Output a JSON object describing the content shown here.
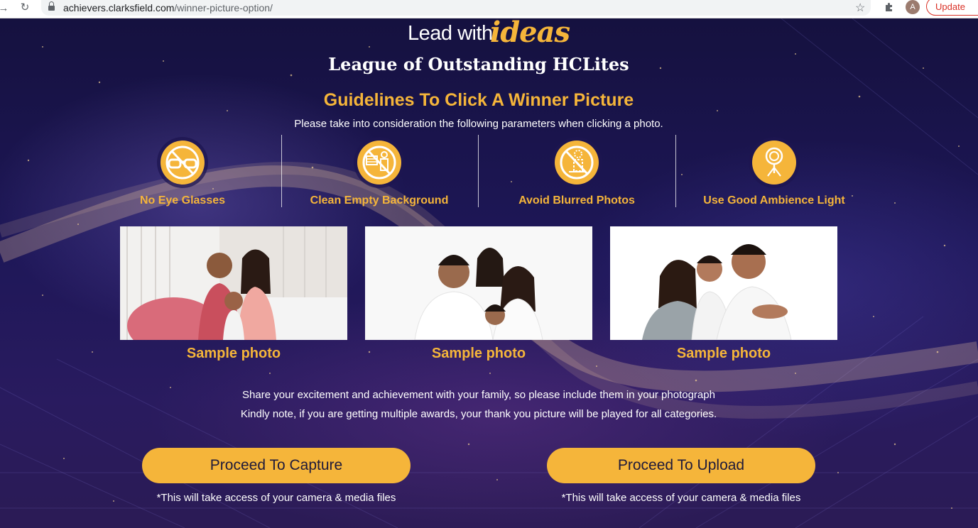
{
  "browser": {
    "url_host": "achievers.clarksfield.com",
    "url_path": "/winner-picture-option/",
    "avatar_letter": "A",
    "update_label": "Update",
    "back_icon": "back-arrow-icon",
    "reload_icon": "reload-icon",
    "star_icon": "star-icon",
    "extensions_icon": "puzzle-icon"
  },
  "header": {
    "logo_lead": "Lead with",
    "logo_ideas": "ideas",
    "league": "League of Outstanding HCLites",
    "title": "Guidelines To Click A Winner Picture",
    "subtitle": "Please take into consideration the following parameters when clicking a photo."
  },
  "guidelines": [
    {
      "label": "No Eye Glasses",
      "icon": "no-glasses-icon"
    },
    {
      "label": "Clean Empty Background",
      "icon": "no-background-icon"
    },
    {
      "label": "Avoid Blurred Photos",
      "icon": "no-blur-icon"
    },
    {
      "label": "Use Good Ambience Light",
      "icon": "light-icon"
    }
  ],
  "samples": [
    {
      "caption": "Sample photo"
    },
    {
      "caption": "Sample photo"
    },
    {
      "caption": "Sample photo"
    }
  ],
  "notes": {
    "line1": "Share your excitement and achievement with your family, so please include them in your photograph",
    "line2": "Kindly note, if you are getting multiple awards, your thank you picture will be played for all categories."
  },
  "actions": {
    "capture_label": "Proceed To Capture",
    "capture_note": "*This will take access of your camera & media files",
    "upload_label": "Proceed To Upload",
    "upload_note": "*This will take access of your camera & media files"
  },
  "colors": {
    "accent": "#f5b53a",
    "background": "#1e1758",
    "text": "#ffffff"
  }
}
